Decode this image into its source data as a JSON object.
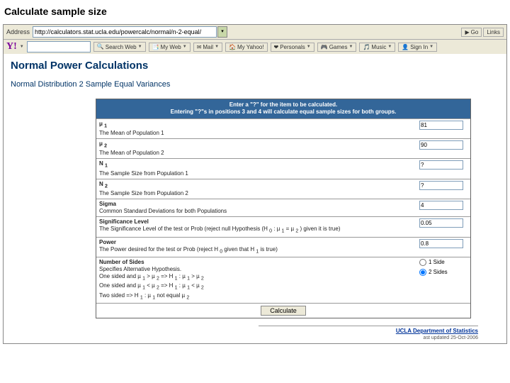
{
  "slide_title": "Calculate sample size",
  "browser": {
    "addr_label": "Address",
    "url": "http://calculators.stat.ucla.edu/powercalc/normal/n-2-equal/",
    "go": "Go",
    "yahoo": {
      "logo": "Y!",
      "search_btn": "Search Web",
      "myweb": "My Web",
      "mail": "Mail",
      "myyahoo": "My Yahoo!",
      "personals": "Personals",
      "games": "Games",
      "music": "Music",
      "signin": "Sign In"
    }
  },
  "page": {
    "h1": "Normal Power Calculations",
    "h2": "Normal Distribution 2 Sample Equal Variances"
  },
  "form": {
    "header_l1": "Enter a \"?\" for the item to be calculated.",
    "header_l2": "Entering \"?\"s in positions 3 and 4 will calculate equal sample sizes for both groups.",
    "rows": {
      "mu1": {
        "title": "µ 1",
        "desc": "The Mean of Population 1",
        "value": "81"
      },
      "mu2": {
        "title": "µ 2",
        "desc": "The Mean of Population 2",
        "value": "90"
      },
      "n1": {
        "title": "N 1",
        "desc": "The Sample Size from Population 1",
        "value": "?"
      },
      "n2": {
        "title": "N 2",
        "desc": "The Sample Size from Population 2",
        "value": "?"
      },
      "sigma": {
        "title": "Sigma",
        "desc": "Common Standard Deviations for both Populations",
        "value": "4"
      },
      "sig": {
        "title": "Significance Level",
        "desc": "The Significance Level of the test or Prob (reject null Hypothesis (H 0 : µ 1 = µ 2 ) given it is true)",
        "value": "0.05"
      },
      "power": {
        "title": "Power",
        "desc": "The Power desired for the test or Prob (reject H 0 given that H 1 is true)",
        "value": "0.8"
      },
      "sides": {
        "title": "Number of Sides",
        "desc1": "Specifies Alternative Hypothesis.",
        "desc2": "One sided and µ 1 > µ 2 => H 1 : µ 1 > µ 2",
        "desc3": "One sided and µ 1 < µ 2 => H 1 : µ 1 < µ 2",
        "desc4": "Two sided => H 1 : µ 1 not equal µ 2",
        "opt1": "1 Side",
        "opt2": "2 Sides"
      }
    },
    "calc_btn": "Calculate"
  },
  "footer": {
    "link": "UCLA Department of Statistics",
    "updated": "ast updated   25-Oct-2006"
  }
}
